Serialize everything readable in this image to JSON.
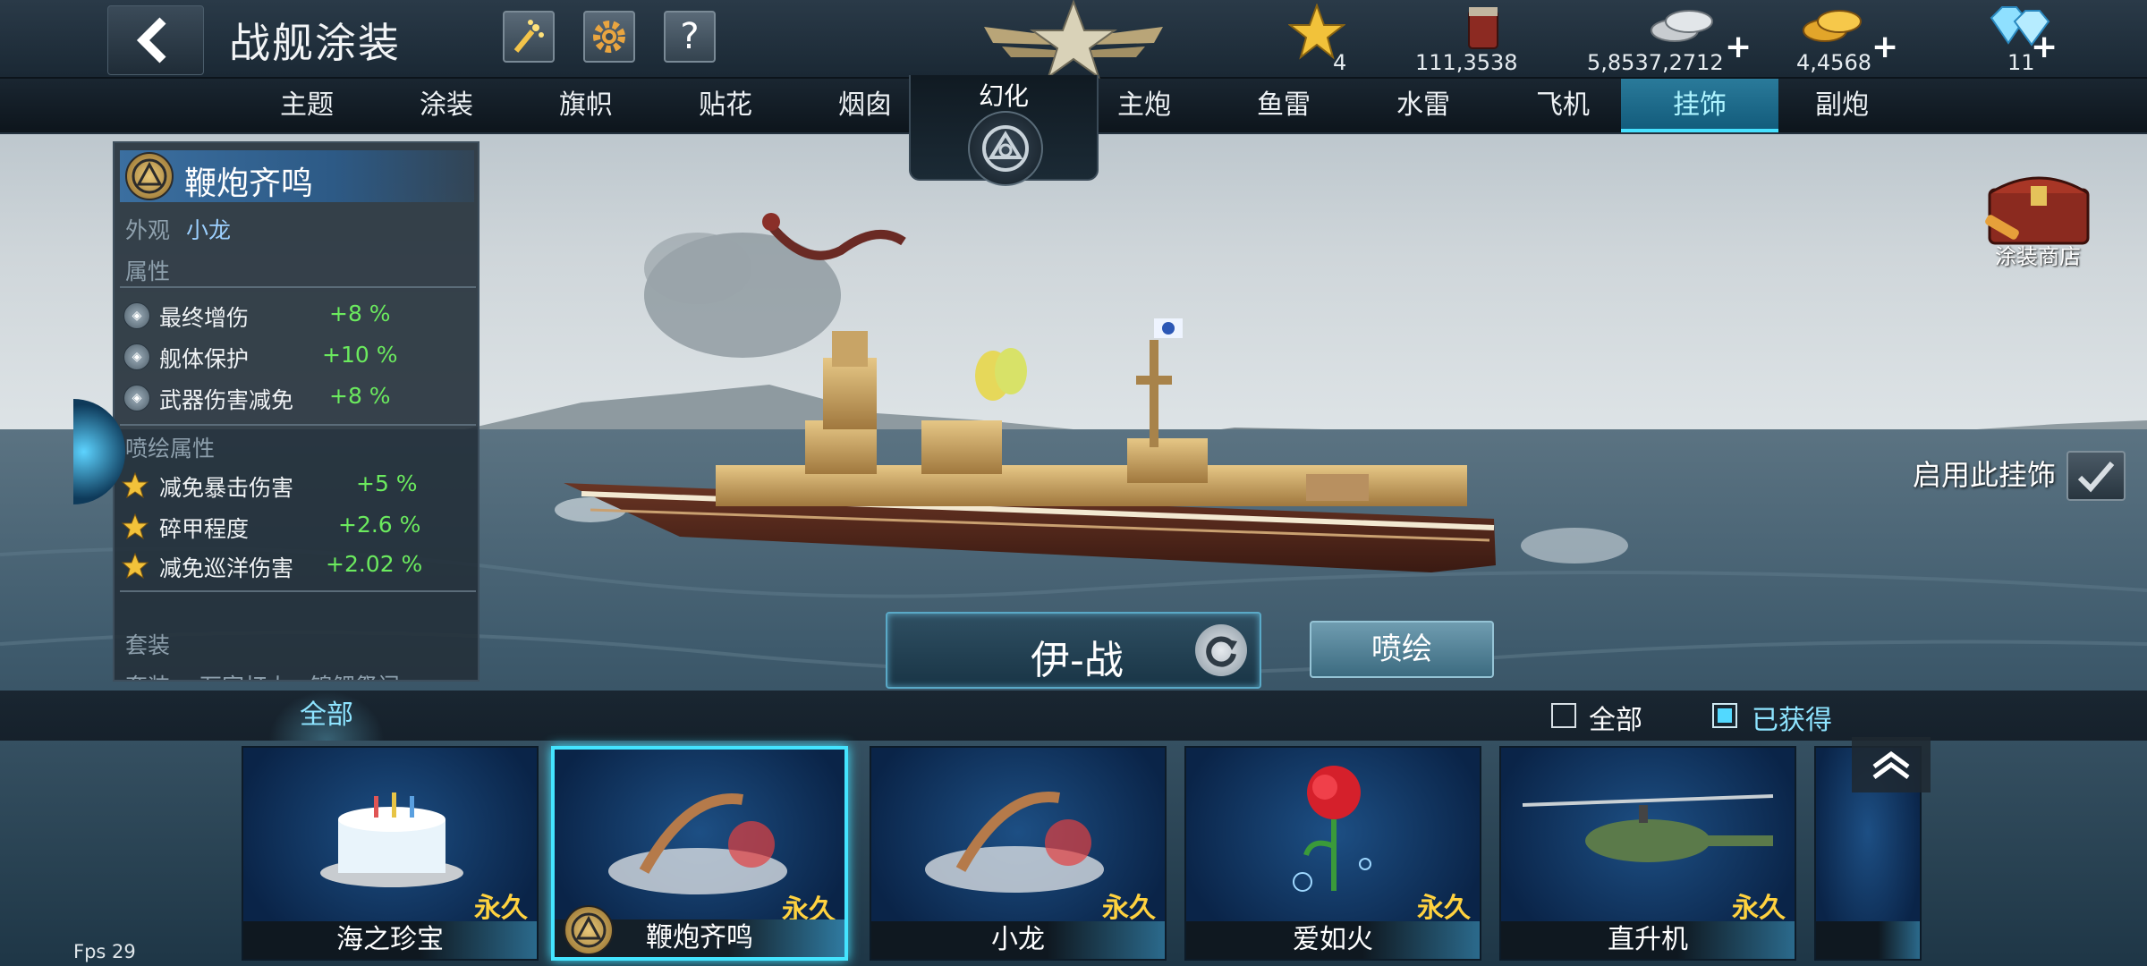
{
  "header": {
    "title": "战舰涂装",
    "icons": [
      "fireworks-icon",
      "gear-icon",
      "help-icon"
    ],
    "help_label": "?",
    "resources": {
      "stars": "4",
      "paint": "111,3538",
      "silver": "5,8537,2712",
      "gold": "4,4568",
      "diamond": "11"
    }
  },
  "tabs": {
    "left": [
      "主题",
      "涂装",
      "旗帜",
      "贴花",
      "烟囱"
    ],
    "center": "幻化",
    "right": [
      "主炮",
      "鱼雷",
      "水雷",
      "飞机",
      "挂饰",
      "副炮"
    ],
    "active": "挂饰"
  },
  "info": {
    "name": "鞭炮齐鸣",
    "appearance_label": "外观",
    "appearance_value": "小龙",
    "attr_heading": "属性",
    "attrs": [
      {
        "label": "最终增伤",
        "value": "+8 %"
      },
      {
        "label": "舰体保护",
        "value": "+10 %"
      },
      {
        "label": "武器伤害减免",
        "value": "+8 %"
      }
    ],
    "spray_heading": "喷绘属性",
    "spray_attrs": [
      {
        "label": "减免暴击伤害",
        "value": "+5 %"
      },
      {
        "label": "碎甲程度",
        "value": "+2.6 %"
      },
      {
        "label": "减免巡洋伤害",
        "value": "+2.02 %"
      }
    ],
    "set_heading": "套装",
    "set_line": "套装： 万家灯火 · 锦鲤祭门"
  },
  "shop_label": "涂装商店",
  "enable_label": "启用此挂饰",
  "ship_name": "伊-战",
  "spray_button": "喷绘",
  "filter": {
    "tab_all": "全部",
    "check_all": "全部",
    "check_obtained": "已获得",
    "obtained_checked": true
  },
  "items": [
    {
      "name": "海之珍宝",
      "duration": "永久",
      "icon": "cake-icon"
    },
    {
      "name": "鞭炮齐鸣",
      "duration": "永久",
      "icon": "firecracker-icon",
      "selected": true
    },
    {
      "name": "小龙",
      "duration": "永久",
      "icon": "firecracker-icon"
    },
    {
      "name": "爱如火",
      "duration": "永久",
      "icon": "rose-icon"
    },
    {
      "name": "直升机",
      "duration": "永久",
      "icon": "helicopter-icon"
    }
  ],
  "fps": "Fps 29"
}
